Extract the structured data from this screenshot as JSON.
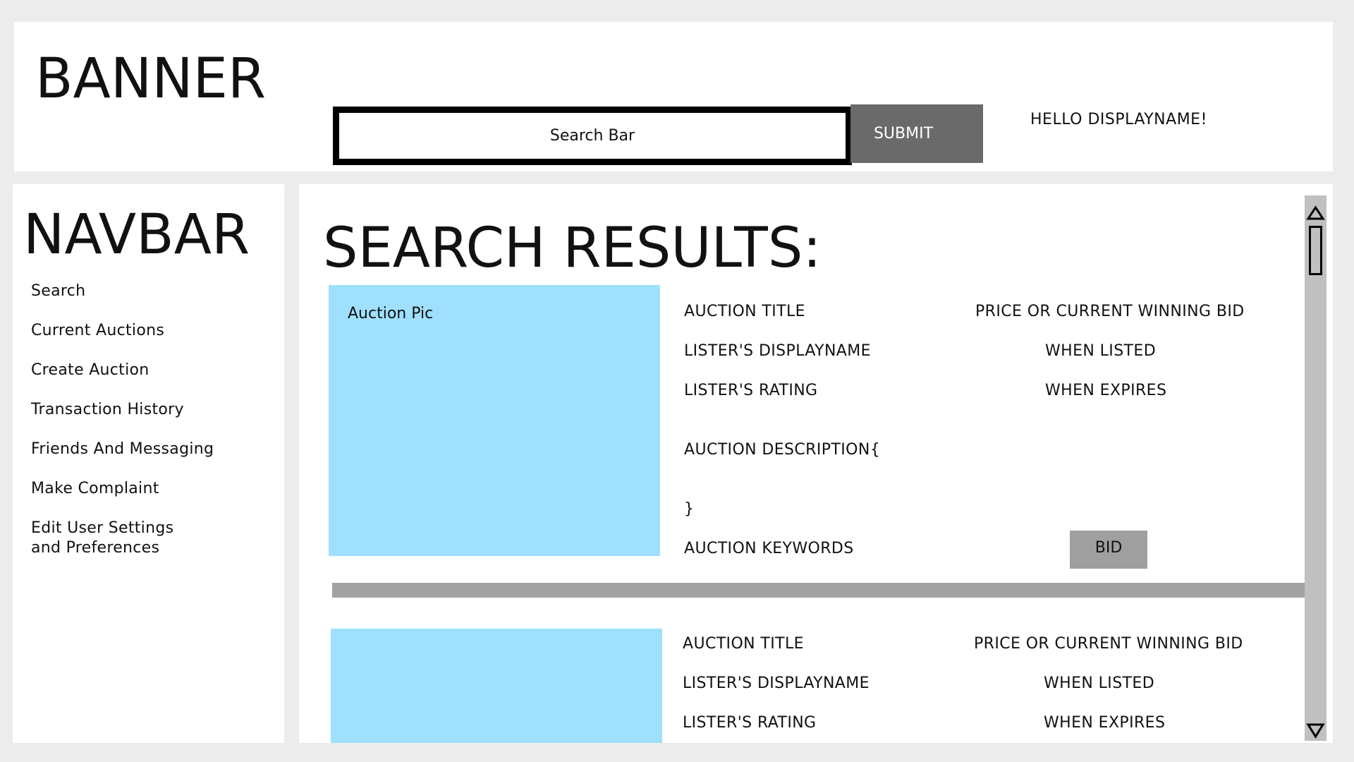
{
  "banner": {
    "title": "BANNER",
    "search_placeholder": "Search Bar",
    "submit_label": "SUBMIT",
    "greeting": "HELLO DISPLAYNAME!"
  },
  "navbar": {
    "title": "NAVBAR",
    "items": [
      {
        "label": "Search"
      },
      {
        "label": "Current Auctions"
      },
      {
        "label": "Create Auction"
      },
      {
        "label": "Transaction History"
      },
      {
        "label": "Friends And Messaging"
      },
      {
        "label": "Make Complaint"
      },
      {
        "label": "Edit User Settings\nand Preferences"
      }
    ]
  },
  "main": {
    "heading": "SEARCH RESULTS:",
    "results": [
      {
        "pic_label": "Auction Pic",
        "title": "AUCTION TITLE",
        "price": "PRICE OR CURRENT WINNING BID",
        "lister": "LISTER'S DISPLAYNAME",
        "when_listed": "WHEN LISTED",
        "rating": "LISTER'S RATING",
        "when_expires": "WHEN EXPIRES",
        "description_open": "AUCTION DESCRIPTION{",
        "description_close": "}",
        "keywords": "AUCTION KEYWORDS",
        "bid_label": "BID"
      },
      {
        "title": "AUCTION TITLE",
        "price": "PRICE OR CURRENT WINNING BID",
        "lister": "LISTER'S DISPLAYNAME",
        "when_listed": "WHEN LISTED",
        "rating": "LISTER'S RATING",
        "when_expires": "WHEN EXPIRES"
      }
    ]
  },
  "colors": {
    "page_background": "#ececec",
    "panel_background": "#ffffff",
    "auction_pic": "#9ee0fe",
    "submit_button": "#6a6a6a",
    "bid_button": "#9f9f9f",
    "separator": "#a2a2a2",
    "scrollbar": "#c0c0c0"
  },
  "icons": {
    "scroll_up": "triangle-up-icon",
    "scroll_down": "triangle-down-icon"
  }
}
